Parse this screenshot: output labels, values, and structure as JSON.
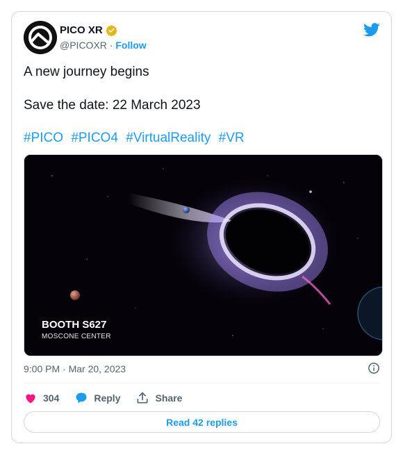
{
  "author": {
    "name": "PICO XR",
    "handle": "@PICOXR",
    "separator": "·",
    "follow_label": "Follow"
  },
  "tweet": {
    "line1": "A new journey begins",
    "line2": "Save the date: 22 March 2023",
    "hashtags": [
      "#PICO",
      "#PICO4",
      "#VirtualReality",
      "#VR"
    ]
  },
  "media": {
    "booth_title": "BOOTH S627",
    "booth_subtitle": "MOSCONE CENTER"
  },
  "meta": {
    "timestamp": "9:00 PM · Mar 20, 2023"
  },
  "actions": {
    "like_count": "304",
    "reply_label": "Reply",
    "share_label": "Share"
  },
  "read_replies_label": "Read 42 replies",
  "colors": {
    "accent": "#1d9bf0",
    "like": "#f91880",
    "verified": "#e2b719",
    "text": "#0f1419",
    "muted": "#536471"
  }
}
